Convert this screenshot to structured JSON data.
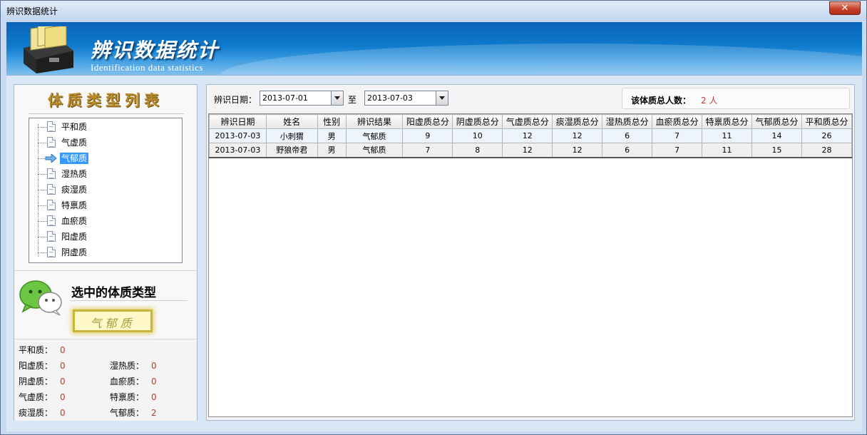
{
  "window": {
    "title": "辨识数据统计",
    "close_label": "✕"
  },
  "banner": {
    "title": "辨识数据统计",
    "subtitle": "Identification data statistics"
  },
  "left": {
    "header": "体质类型列表",
    "tree": [
      {
        "label": "平和质"
      },
      {
        "label": "气虚质"
      },
      {
        "label": "气郁质"
      },
      {
        "label": "湿热质"
      },
      {
        "label": "痰湿质"
      },
      {
        "label": "特禀质"
      },
      {
        "label": "血瘀质"
      },
      {
        "label": "阳虚质"
      },
      {
        "label": "阴虚质"
      }
    ],
    "selected_index": 2,
    "selected_title": "选中的体质类型",
    "selected_value": "气郁质",
    "counts": {
      "pinghe": {
        "label": "平和质：",
        "value": "0"
      },
      "yangxu": {
        "label": "阳虚质：",
        "value": "0"
      },
      "shire": {
        "label": "湿热质：",
        "value": "0"
      },
      "yinxu": {
        "label": "阴虚质：",
        "value": "0"
      },
      "xueyu": {
        "label": "血瘀质：",
        "value": "0"
      },
      "qixu": {
        "label": "气虚质：",
        "value": "0"
      },
      "tebing": {
        "label": "特禀质：",
        "value": "0"
      },
      "tanshi": {
        "label": "痰湿质：",
        "value": "0"
      },
      "qiyu": {
        "label": "气郁质：",
        "value": "2"
      }
    }
  },
  "filter": {
    "label": "辨识日期：",
    "from": "2013-07-01",
    "to_label": "至",
    "to": "2013-07-03",
    "total_label": "该体质总人数：",
    "total_value": "2 人"
  },
  "table": {
    "columns": [
      "辨识日期",
      "姓名",
      "性别",
      "辨识结果",
      "阳虚质总分",
      "阴虚质总分",
      "气虚质总分",
      "痰湿质总分",
      "湿热质总分",
      "血瘀质总分",
      "特禀质总分",
      "气郁质总分",
      "平和质总分"
    ],
    "rows": [
      [
        "2013-07-03",
        "小刺猬",
        "男",
        "气郁质",
        "9",
        "10",
        "12",
        "12",
        "6",
        "7",
        "11",
        "14",
        "26"
      ],
      [
        "2013-07-03",
        "野狼帝君",
        "男",
        "气郁质",
        "7",
        "8",
        "12",
        "12",
        "6",
        "7",
        "11",
        "15",
        "28"
      ]
    ]
  },
  "colors": {
    "banner": "#0e7acc",
    "selected": "#3399ff",
    "value_red": "#c0392b",
    "accent_gold": "#b98a2a"
  }
}
